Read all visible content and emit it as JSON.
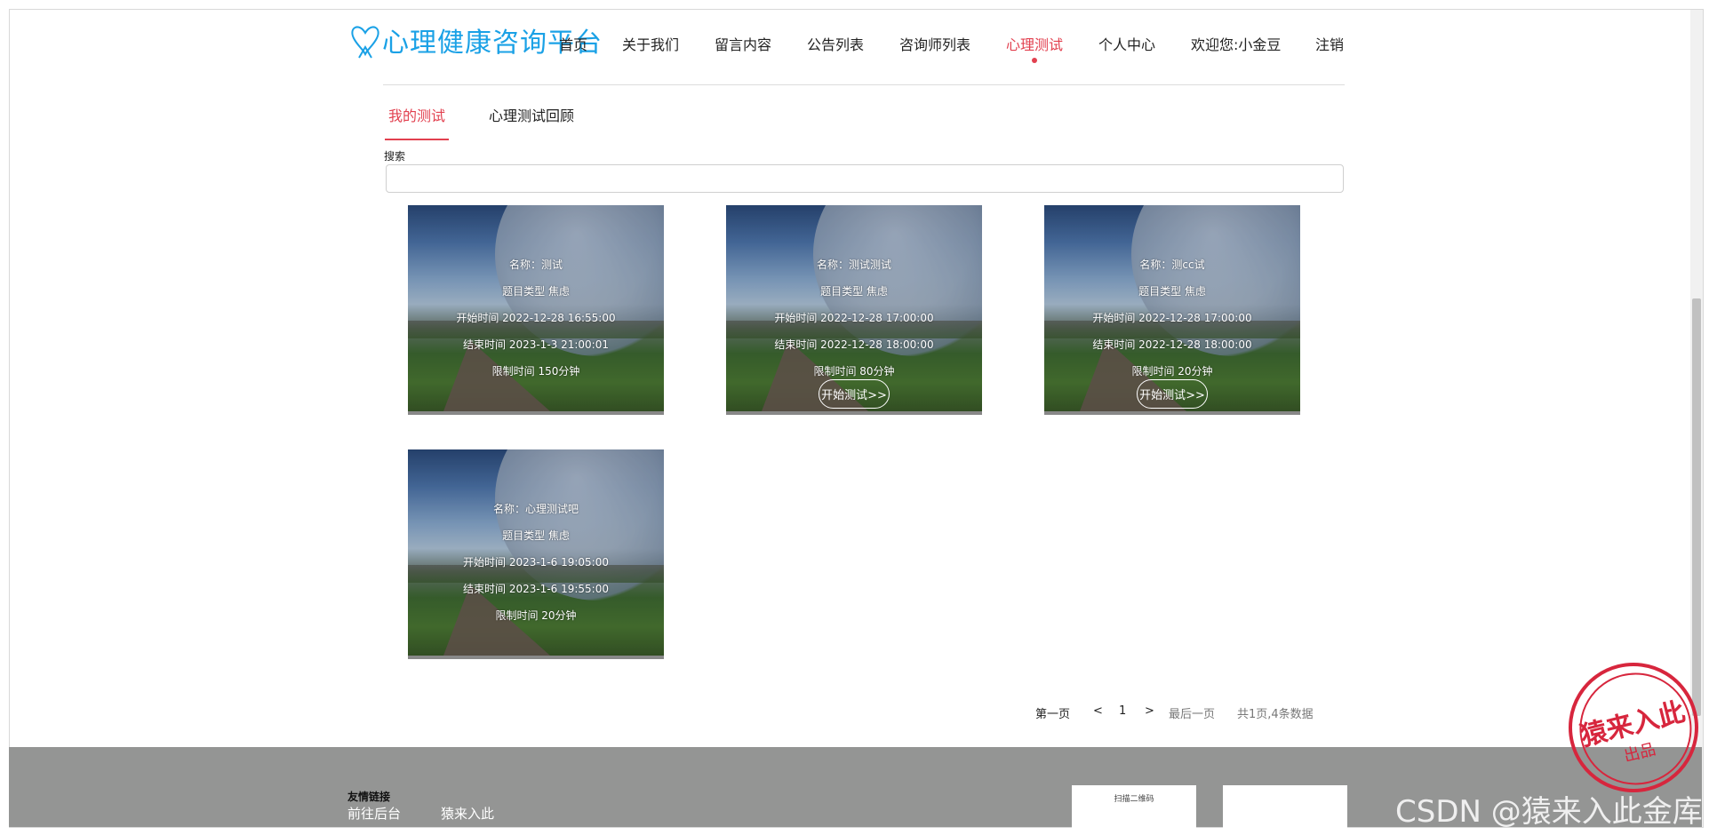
{
  "brand": {
    "title": "心理健康咨询平台"
  },
  "nav": {
    "items": [
      {
        "label": "首页"
      },
      {
        "label": "关于我们"
      },
      {
        "label": "留言内容"
      },
      {
        "label": "公告列表"
      },
      {
        "label": "咨询师列表"
      },
      {
        "label": "心理测试"
      },
      {
        "label": "个人中心"
      },
      {
        "label": "欢迎您:小金豆"
      },
      {
        "label": "注销"
      }
    ]
  },
  "tabs": [
    {
      "label": "我的测试"
    },
    {
      "label": "心理测试回顾"
    }
  ],
  "search": {
    "label": "搜索",
    "value": "",
    "placeholder": ""
  },
  "cards": [
    {
      "name": "名称：测试",
      "type": "题目类型 焦虑",
      "start": "开始时间 2022-12-28 16:55:00",
      "end": "结束时间 2023-1-3 21:00:01",
      "limit": "限制时间 150分钟"
    },
    {
      "name": "名称：测试测试",
      "type": "题目类型 焦虑",
      "start": "开始时间 2022-12-28 17:00:00",
      "end": "结束时间 2022-12-28 18:00:00",
      "limit": "限制时间 80分钟",
      "button": "开始测试>>"
    },
    {
      "name": "名称：测cc试",
      "type": "题目类型 焦虑",
      "start": "开始时间 2022-12-28 17:00:00",
      "end": "结束时间 2022-12-28 18:00:00",
      "limit": "限制时间 20分钟",
      "button": "开始测试>>"
    },
    {
      "name": "名称：心理测试吧",
      "type": "题目类型 焦虑",
      "start": "开始时间 2023-1-6 19:05:00",
      "end": "结束时间 2023-1-6 19:55:00",
      "limit": "限制时间 20分钟"
    }
  ],
  "pagination": {
    "first": "第一页",
    "prev": "<",
    "current": "1",
    "next": ">",
    "last": "最后一页",
    "summary": "共1页,4条数据"
  },
  "footer": {
    "links_title": "友情链接",
    "links": [
      {
        "label": "前往后台"
      },
      {
        "label": "猿来入此"
      }
    ],
    "qr_label": "扫描二维码"
  },
  "watermark": {
    "text": "CSDN @猿来入此金库",
    "stamp_main": "猿来入此",
    "stamp_sub": "出品"
  }
}
